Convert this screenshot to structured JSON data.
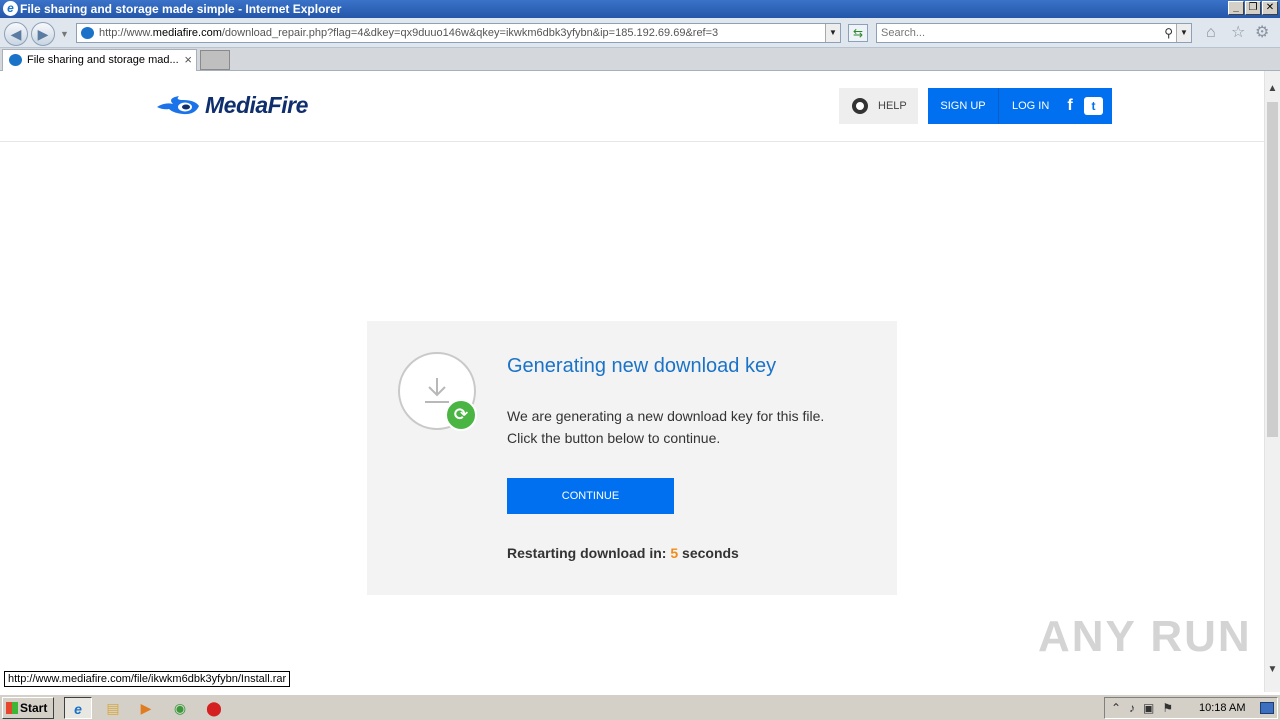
{
  "window": {
    "title": "File sharing and storage made simple - Internet Explorer",
    "min_label": "_",
    "restore_label": "❐",
    "close_label": "✕"
  },
  "browser": {
    "url_prefix": "http://www.",
    "url_domain": "mediafire.com",
    "url_path": "/download_repair.php?flag=4&dkey=qx9duuo146w&qkey=ikwkm6dbk3yfybn&ip=185.192.69.69&ref=3",
    "search_placeholder": "Search...",
    "tab_title": "File sharing and storage mad...",
    "tab_close": "×"
  },
  "header": {
    "logo_text": "MediaFire",
    "help_label": "HELP",
    "signup_label": "SIGN UP",
    "login_label": "LOG IN",
    "facebook_glyph": "f",
    "twitter_glyph": "t"
  },
  "card": {
    "title": "Generating new download key",
    "desc_line1": "We are generating a new download key for this file.",
    "desc_line2": "Click the button below to continue.",
    "continue_label": "CONTINUE",
    "restart_prefix": "Restarting download in:",
    "countdown": "5",
    "restart_suffix": "seconds"
  },
  "status_url": "http://www.mediafire.com/file/ikwkm6dbk3yfybn/Install.rar",
  "watermark": "ANY RUN",
  "taskbar": {
    "start_label": "Start",
    "clock": "10:18 AM"
  },
  "colors": {
    "accent": "#0070f0",
    "title_blue": "#1a73c8",
    "countdown_orange": "#f28c18",
    "refresh_green": "#4bb543"
  }
}
